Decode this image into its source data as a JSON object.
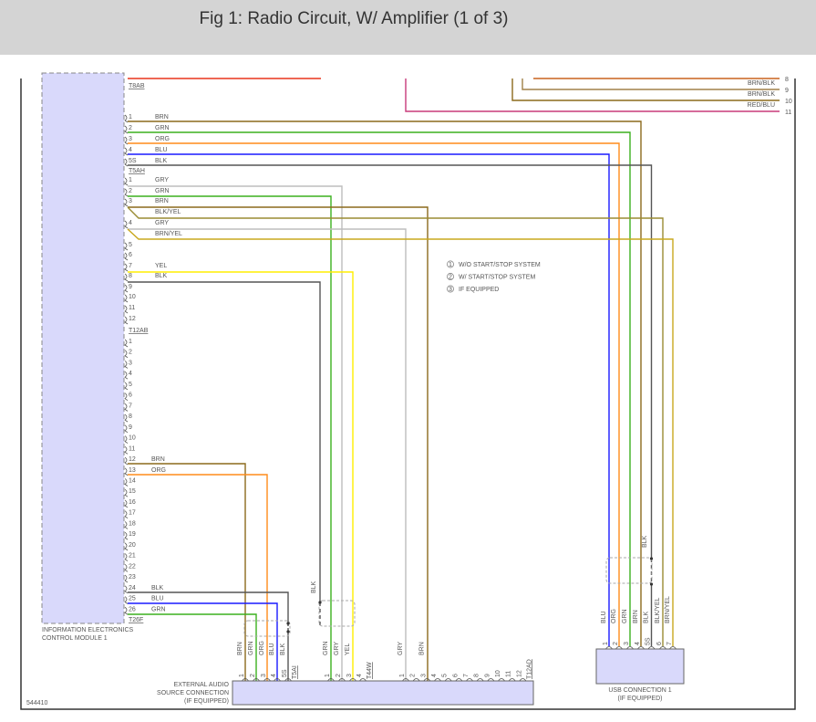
{
  "header": {
    "title": "Fig 1: Radio Circuit, W/ Amplifier (1 of 3)"
  },
  "diagram_id": "544410",
  "wire_colors": {
    "BRN": "#8b6a1c",
    "GRN": "#3cb01e",
    "ORG": "#ff8c1a",
    "BLU": "#1a1aff",
    "BLK": "#555555",
    "GRY": "#bdbdbd",
    "YEL": "#ffee00",
    "BLK/YEL": "#9a8c34",
    "BRN/YEL": "#c9a81e",
    "RED": "#e8341c",
    "RED/BLU": "#c83a7a",
    "BRN/BLK": "#a08048",
    "BRN/ORG": "#c8641e",
    "module_fill": "#d9d9fb"
  },
  "module": {
    "name": [
      "INFORMATION ELECTRONICS",
      "CONTROL MODULE 1"
    ],
    "connectors": {
      "top": "T8AB",
      "a": "T5AH",
      "b": "T12AB",
      "c": "T26F"
    },
    "group_a": [
      {
        "pin": "1",
        "wire": "BRN"
      },
      {
        "pin": "2",
        "wire": "GRN"
      },
      {
        "pin": "3",
        "wire": "ORG"
      },
      {
        "pin": "4",
        "wire": "BLU"
      },
      {
        "pin": "5S",
        "wire": "BLK"
      }
    ],
    "group_b": [
      {
        "pin": "1",
        "wire": "GRY"
      },
      {
        "pin": "2",
        "wire": "GRN"
      },
      {
        "pin": "3",
        "wire": "BRN"
      },
      {
        "pin": "",
        "wire": "BLK/YEL"
      },
      {
        "pin": "4",
        "wire": "GRY"
      },
      {
        "pin": "",
        "wire": "BRN/YEL"
      },
      {
        "pin": "5",
        "wire": ""
      },
      {
        "pin": "6",
        "wire": ""
      },
      {
        "pin": "7",
        "wire": "YEL"
      },
      {
        "pin": "8",
        "wire": "BLK"
      },
      {
        "pin": "9",
        "wire": ""
      },
      {
        "pin": "10",
        "wire": ""
      },
      {
        "pin": "11",
        "wire": ""
      },
      {
        "pin": "12",
        "wire": ""
      }
    ],
    "group_c": [
      {
        "pin": "1",
        "wire": ""
      },
      {
        "pin": "2",
        "wire": ""
      },
      {
        "pin": "3",
        "wire": ""
      },
      {
        "pin": "4",
        "wire": ""
      },
      {
        "pin": "5",
        "wire": ""
      },
      {
        "pin": "6",
        "wire": ""
      },
      {
        "pin": "7",
        "wire": ""
      },
      {
        "pin": "8",
        "wire": ""
      },
      {
        "pin": "9",
        "wire": ""
      },
      {
        "pin": "10",
        "wire": ""
      },
      {
        "pin": "11",
        "wire": ""
      },
      {
        "pin": "12",
        "wire": "BRN"
      },
      {
        "pin": "13",
        "wire": "ORG"
      },
      {
        "pin": "14",
        "wire": ""
      },
      {
        "pin": "15",
        "wire": ""
      },
      {
        "pin": "16",
        "wire": ""
      },
      {
        "pin": "17",
        "wire": ""
      },
      {
        "pin": "18",
        "wire": ""
      },
      {
        "pin": "19",
        "wire": ""
      },
      {
        "pin": "20",
        "wire": ""
      },
      {
        "pin": "21",
        "wire": ""
      },
      {
        "pin": "22",
        "wire": ""
      },
      {
        "pin": "23",
        "wire": ""
      },
      {
        "pin": "24",
        "wire": "BLK"
      },
      {
        "pin": "25",
        "wire": "BLU"
      },
      {
        "pin": "26",
        "wire": "GRN"
      }
    ]
  },
  "top_right": [
    {
      "pin": "8",
      "wire": ""
    },
    {
      "pin": "9",
      "wire": "BRN/BLK"
    },
    {
      "pin": "10",
      "wire": "BRN/BLK"
    },
    {
      "pin": "11",
      "wire": "RED/BLU"
    }
  ],
  "legend": [
    {
      "num": "1",
      "text": "W/O START/STOP SYSTEM"
    },
    {
      "num": "2",
      "text": "W/ START/STOP SYSTEM"
    },
    {
      "num": "3",
      "text": "IF EQUIPPED"
    }
  ],
  "external_audio": {
    "name": [
      "EXTERNAL AUDIO",
      "SOURCE CONNECTION",
      "(IF EQUIPPED)"
    ],
    "shield_label": "BLK",
    "groups": [
      {
        "connector": "T5AI",
        "pins": [
          {
            "pin": "1",
            "wire": "BRN"
          },
          {
            "pin": "2",
            "wire": "GRN"
          },
          {
            "pin": "3",
            "wire": "ORG"
          },
          {
            "pin": "4",
            "wire": "BLU"
          },
          {
            "pin": "5S",
            "wire": "BLK"
          }
        ]
      },
      {
        "connector": "T44W",
        "pins": [
          {
            "pin": "1",
            "wire": "GRN"
          },
          {
            "pin": "2",
            "wire": "GRY"
          },
          {
            "pin": "3",
            "wire": "YEL"
          },
          {
            "pin": "4",
            "wire": ""
          }
        ]
      },
      {
        "connector": "T12AD",
        "pins": [
          {
            "pin": "1",
            "wire": "GRY"
          },
          {
            "pin": "2",
            "wire": ""
          },
          {
            "pin": "3",
            "wire": "BRN"
          },
          {
            "pin": "4",
            "wire": ""
          },
          {
            "pin": "5",
            "wire": ""
          },
          {
            "pin": "6",
            "wire": ""
          },
          {
            "pin": "7",
            "wire": ""
          },
          {
            "pin": "8",
            "wire": ""
          },
          {
            "pin": "9",
            "wire": ""
          },
          {
            "pin": "10",
            "wire": ""
          },
          {
            "pin": "11",
            "wire": ""
          },
          {
            "pin": "12",
            "wire": ""
          }
        ]
      }
    ]
  },
  "usb": {
    "name": [
      "USB CONNECTION 1",
      "(IF EQUIPPED)"
    ],
    "shield_label": "BLK",
    "pins": [
      {
        "pin": "1",
        "wire": "BLU"
      },
      {
        "pin": "2",
        "wire": "ORG"
      },
      {
        "pin": "3",
        "wire": "GRN"
      },
      {
        "pin": "4",
        "wire": "BRN"
      },
      {
        "pin": "5S",
        "wire": "BLK"
      },
      {
        "pin": "6",
        "wire": "BLK/YEL"
      },
      {
        "pin": "7",
        "wire": "BRN/YEL"
      }
    ]
  }
}
